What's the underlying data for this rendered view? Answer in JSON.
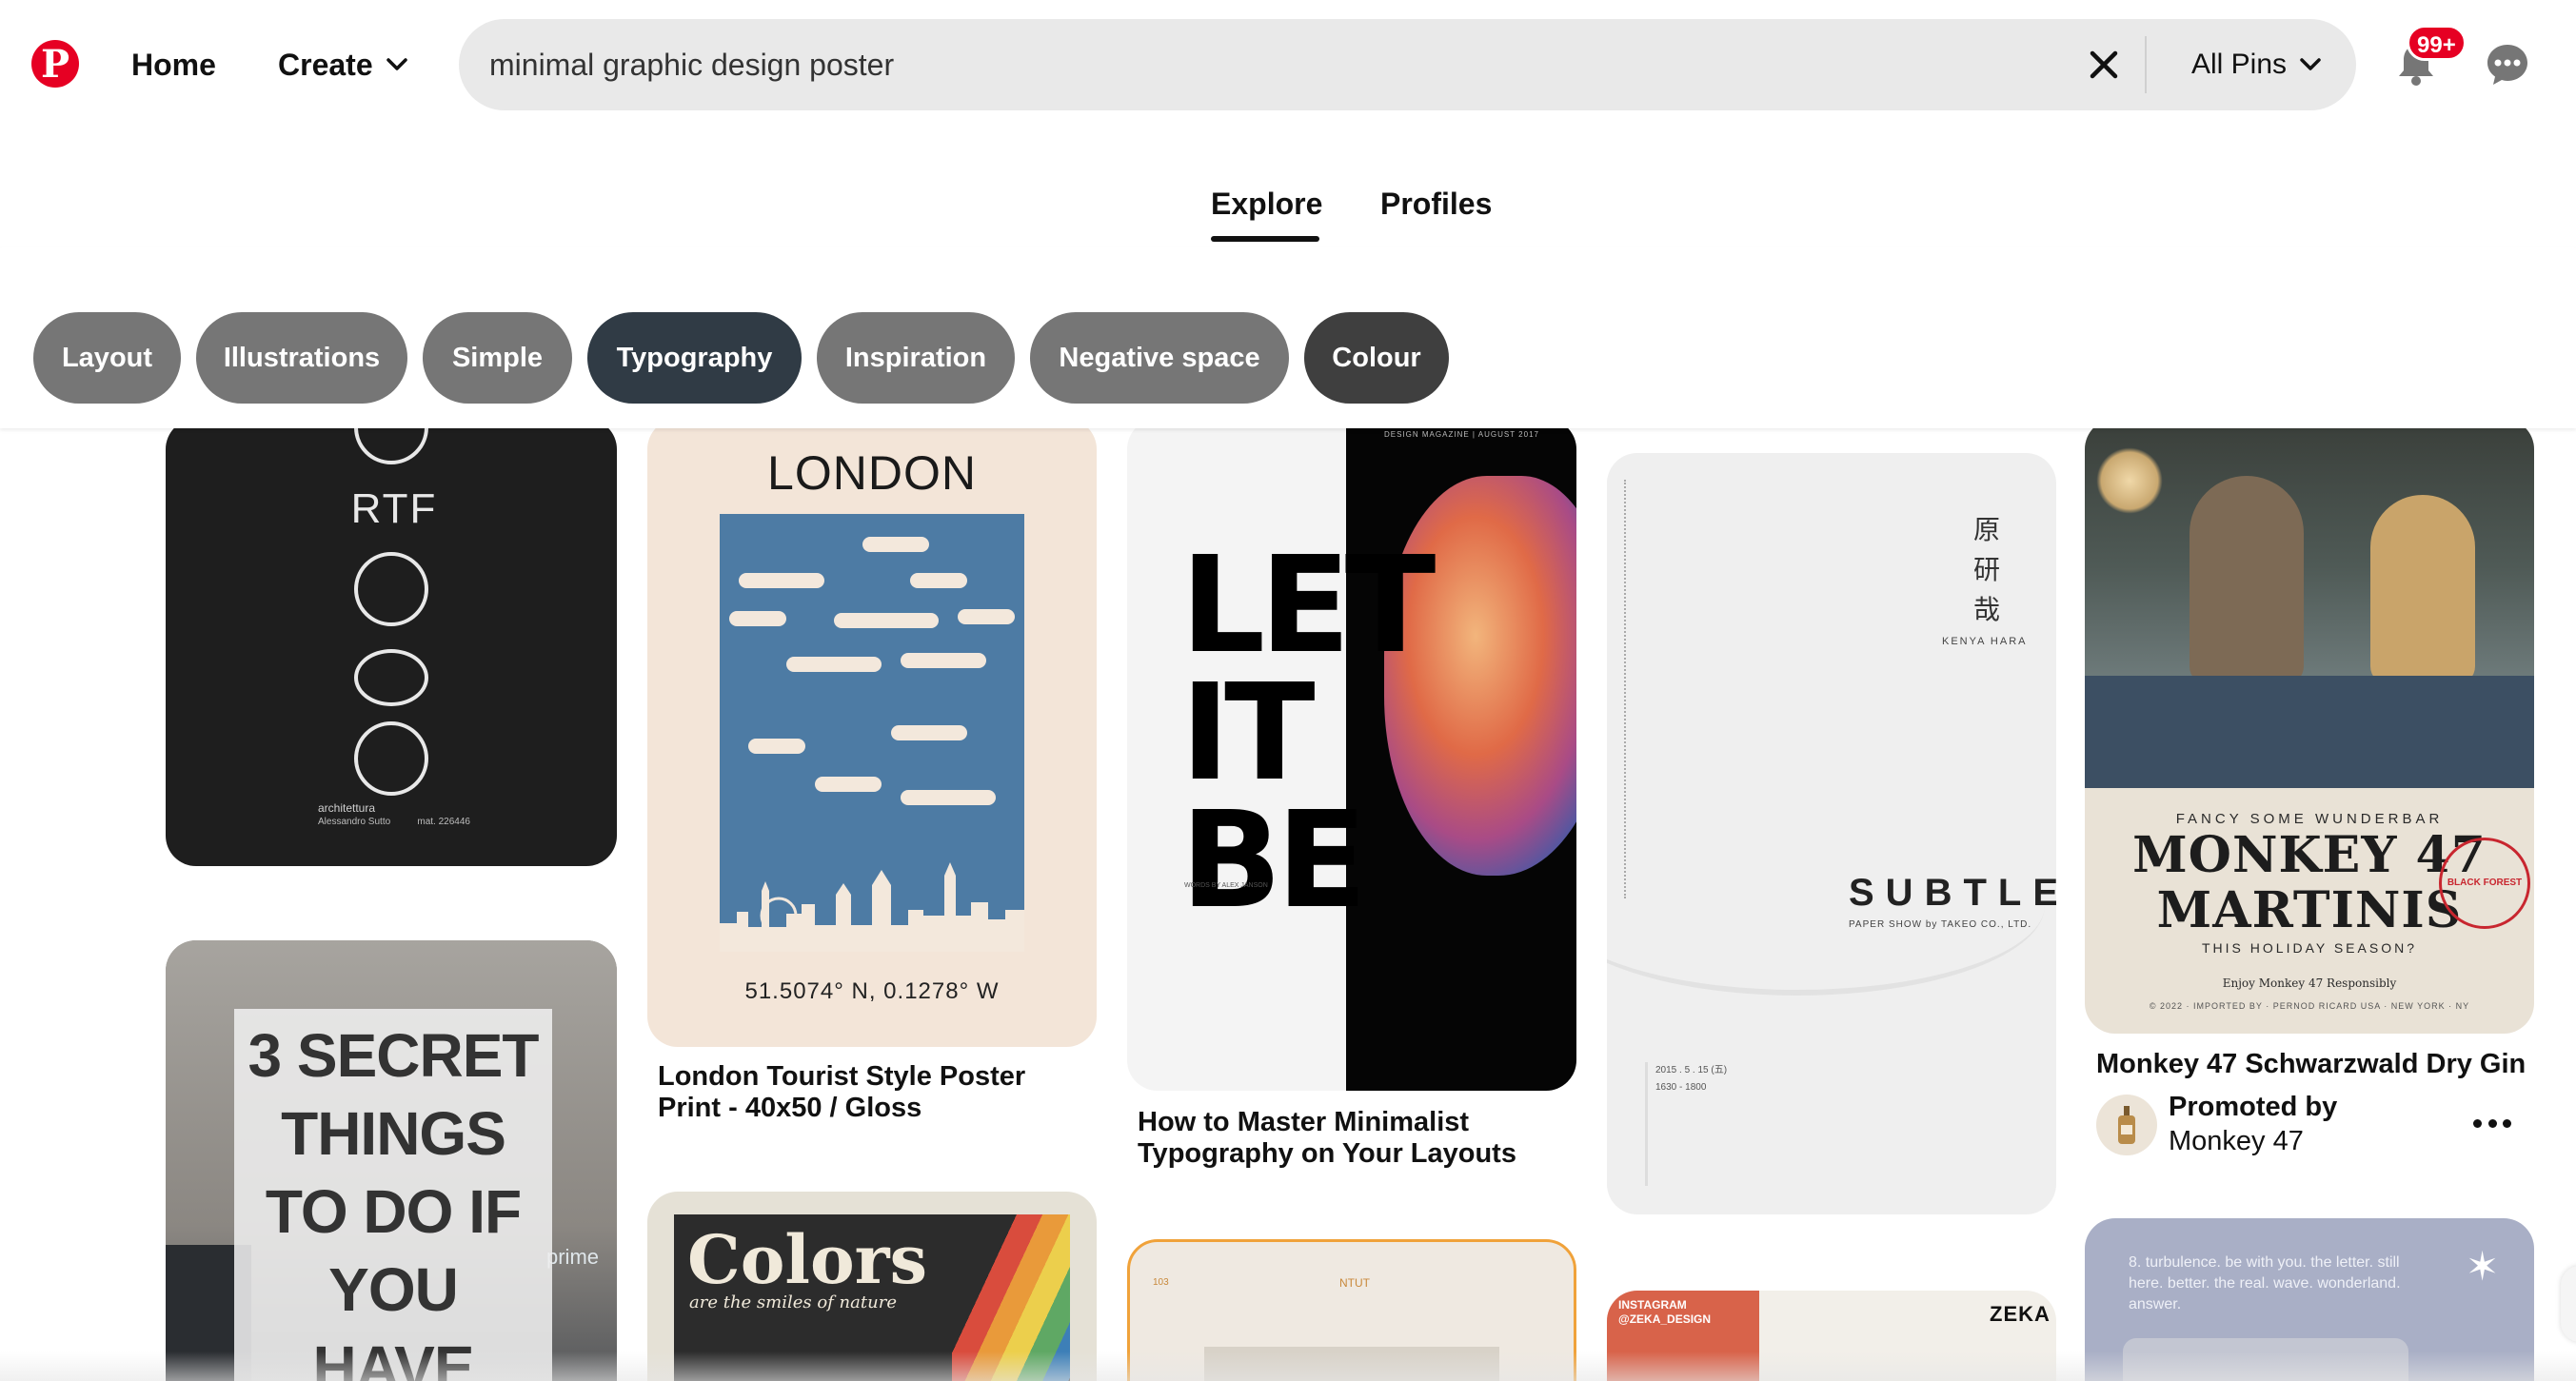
{
  "header": {
    "logo_letter": "P",
    "nav": {
      "home": "Home",
      "create": "Create"
    },
    "search": {
      "value": "minimal graphic design poster",
      "filter_label": "All Pins"
    },
    "notifications_badge": "99+"
  },
  "tabs": [
    {
      "label": "Explore",
      "active": true
    },
    {
      "label": "Profiles",
      "active": false
    }
  ],
  "chips": [
    {
      "label": "Layout"
    },
    {
      "label": "Illustrations"
    },
    {
      "label": "Simple"
    },
    {
      "label": "Typography",
      "selected": true
    },
    {
      "label": "Inspiration"
    },
    {
      "label": "Negative space"
    },
    {
      "label": "Colour"
    }
  ],
  "pins": {
    "p1": {
      "rtf": "RTF",
      "caption": "architettura",
      "author": "Alessandro Sutto",
      "mat": "mat. 226446"
    },
    "p2": {
      "headline_lines": [
        "3 SECRET",
        "THINGS",
        "TO DO IF",
        "YOU",
        "HAVE"
      ],
      "truck_text": "prime"
    },
    "p3": {
      "poster_title": "LONDON",
      "coords": "51.5074° N, 0.1278° W",
      "title": "London Tourist Style Poster Print - 40x50 / Gloss"
    },
    "p4": {
      "poster_title": "Colors",
      "poster_sub": "are the smiles of nature"
    },
    "p5": {
      "headline_lines": [
        "LET",
        "IT",
        "BE"
      ],
      "byline": "WORDS BY ALEX JANSON",
      "mag": "DESIGN MAGAZINE | AUGUST 2017",
      "title": "How to Master Minimalist Typography on Your Layouts"
    },
    "p6": {
      "label": "NTUT",
      "tag": "103"
    },
    "p7": {
      "kanji": "原研哉",
      "name": "KENYA HARA",
      "word": "SUBTLE",
      "paper": "PAPER SHOW by TAKEO CO., LTD.",
      "date": "2015 . 5 . 15 (五)",
      "time": "1630 - 1800"
    },
    "p8": {
      "ig": "INSTAGRAM",
      "handle": "@ZEKA_DESIGN",
      "brand": "ZEKA"
    },
    "p9": {
      "fancy": "FANCY SOME WUNDERBAR",
      "headline_lines": [
        "MONKEY 47",
        "MARTINIS"
      ],
      "holiday": "THIS HOLIDAY SEASON?",
      "responsibly": "Enjoy Monkey 47 Responsibly",
      "legal": "© 2022 · IMPORTED BY · PERNOD RICARD USA · NEW YORK · NY",
      "stamp": "BLACK FOREST",
      "title": "Monkey 47 Schwarzwald Dry Gin",
      "promoted_by": "Promoted by",
      "advertiser": "Monkey 47"
    },
    "p10": {
      "poem": "8. turbulence. be with you. the letter. still here. better. the real. wave. wonderland. answer."
    }
  },
  "colors": {
    "brand": "#e60023",
    "chip": "#767676",
    "chip_selected": "#303b45"
  }
}
